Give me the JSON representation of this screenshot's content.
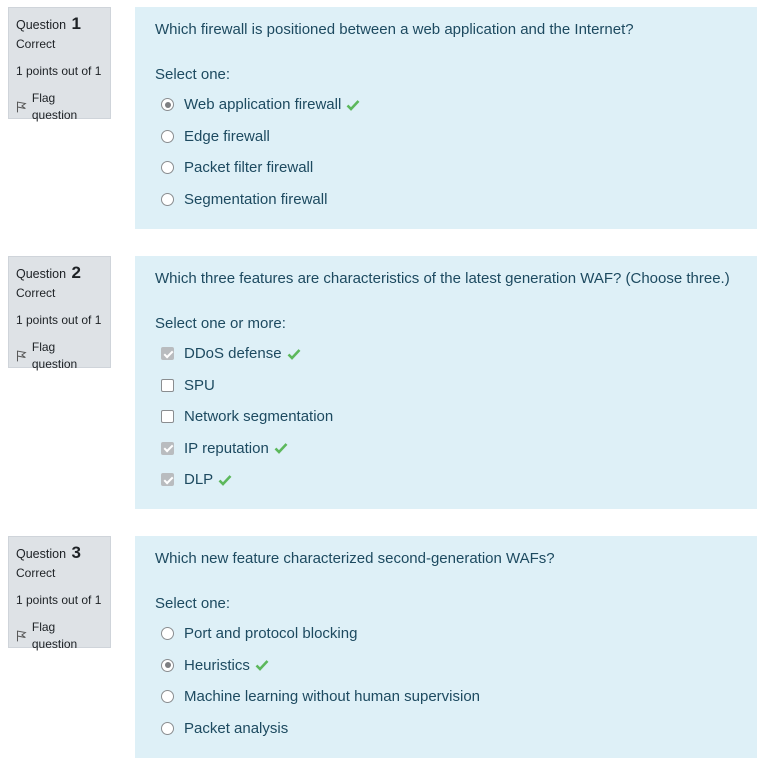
{
  "questions": [
    {
      "label": "Question",
      "number": "1",
      "state": "Correct",
      "grade": "1 points out of 1",
      "flag_label": "Flag question",
      "text": "Which firewall is positioned between a web application and the Internet?",
      "prompt": "Select one:",
      "input_type": "radio",
      "answers": [
        {
          "label": "Web application firewall",
          "checked": true,
          "correct": true
        },
        {
          "label": "Edge firewall",
          "checked": false,
          "correct": false
        },
        {
          "label": "Packet filter firewall",
          "checked": false,
          "correct": false
        },
        {
          "label": "Segmentation firewall",
          "checked": false,
          "correct": false
        }
      ]
    },
    {
      "label": "Question",
      "number": "2",
      "state": "Correct",
      "grade": "1 points out of 1",
      "flag_label": "Flag question",
      "text": "Which three features are characteristics of the latest generation WAF? (Choose three.)",
      "prompt": "Select one or more:",
      "input_type": "checkbox",
      "answers": [
        {
          "label": "DDoS defense",
          "checked": true,
          "correct": true
        },
        {
          "label": "SPU",
          "checked": false,
          "correct": false
        },
        {
          "label": "Network segmentation",
          "checked": false,
          "correct": false
        },
        {
          "label": "IP reputation",
          "checked": true,
          "correct": true
        },
        {
          "label": "DLP",
          "checked": true,
          "correct": true
        }
      ]
    },
    {
      "label": "Question",
      "number": "3",
      "state": "Correct",
      "grade": "1 points out of 1",
      "flag_label": "Flag question",
      "text": "Which new feature characterized second-generation WAFs?",
      "prompt": "Select one:",
      "input_type": "radio",
      "answers": [
        {
          "label": "Port and protocol blocking",
          "checked": false,
          "correct": false
        },
        {
          "label": "Heuristics",
          "checked": true,
          "correct": true
        },
        {
          "label": "Machine learning without human supervision",
          "checked": false,
          "correct": false
        },
        {
          "label": "Packet analysis",
          "checked": false,
          "correct": false
        }
      ]
    }
  ],
  "colors": {
    "info_bg": "#dee2e6",
    "content_bg": "#def0f7",
    "text": "#1d4a60",
    "correct_tick": "#5cb85c"
  },
  "icons": {
    "flag": "flag-icon",
    "correct": "check-mark-icon"
  }
}
